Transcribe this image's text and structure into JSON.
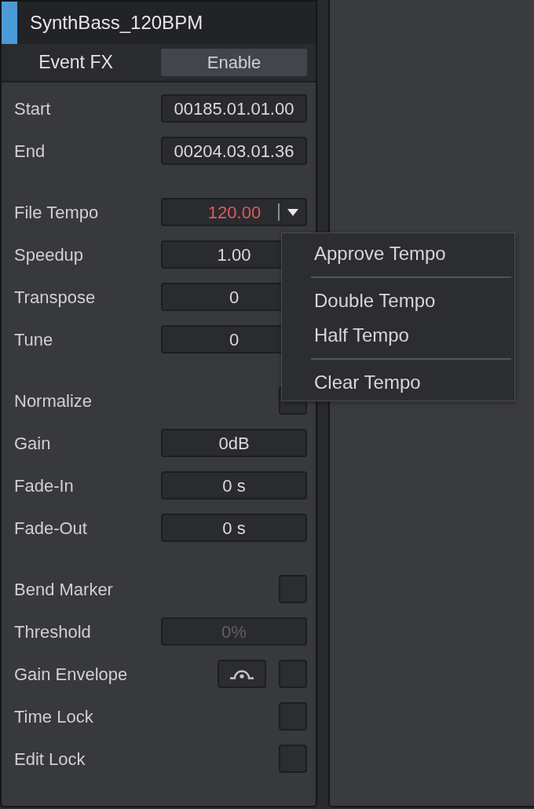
{
  "header": {
    "title": "SynthBass_120BPM"
  },
  "event_fx": {
    "label": "Event FX",
    "button": "Enable"
  },
  "sections": [
    {
      "rows": [
        {
          "kind": "field",
          "label": "Start",
          "value": "00185.01.01.00",
          "disabled": false
        },
        {
          "kind": "field",
          "label": "End",
          "value": "00204.03.01.36",
          "disabled": false
        }
      ]
    },
    {
      "rows": [
        {
          "kind": "dropdown",
          "label": "File Tempo",
          "value": "120.00"
        },
        {
          "kind": "field",
          "label": "Speedup",
          "value": "1.00",
          "disabled": false
        },
        {
          "kind": "field",
          "label": "Transpose",
          "value": "0",
          "disabled": false
        },
        {
          "kind": "field",
          "label": "Tune",
          "value": "0",
          "disabled": false
        }
      ]
    },
    {
      "rows": [
        {
          "kind": "checkbox",
          "label": "Normalize",
          "checked": false
        },
        {
          "kind": "field",
          "label": "Gain",
          "value": "0dB",
          "disabled": false
        },
        {
          "kind": "field",
          "label": "Fade-In",
          "value": "0 s",
          "disabled": false
        },
        {
          "kind": "field",
          "label": "Fade-Out",
          "value": "0 s",
          "disabled": false
        }
      ]
    },
    {
      "rows": [
        {
          "kind": "checkbox",
          "label": "Bend Marker",
          "checked": false
        },
        {
          "kind": "field",
          "label": "Threshold",
          "value": "0%",
          "disabled": true
        },
        {
          "kind": "envelope",
          "label": "Gain Envelope",
          "checked": false
        },
        {
          "kind": "checkbox",
          "label": "Time Lock",
          "checked": false
        },
        {
          "kind": "checkbox",
          "label": "Edit Lock",
          "checked": false
        }
      ]
    }
  ],
  "menu": {
    "items": [
      {
        "kind": "item",
        "label": "Approve Tempo"
      },
      {
        "kind": "separator"
      },
      {
        "kind": "item",
        "label": "Double Tempo"
      },
      {
        "kind": "item",
        "label": "Half Tempo"
      },
      {
        "kind": "separator"
      },
      {
        "kind": "item",
        "label": "Clear Tempo"
      }
    ]
  }
}
